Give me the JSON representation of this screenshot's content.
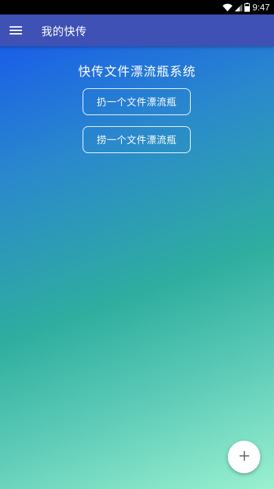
{
  "status_bar": {
    "time": "9:47",
    "icons": [
      "wifi-icon",
      "signal-icon",
      "battery-icon"
    ]
  },
  "app_bar": {
    "menu_icon": "hamburger-menu-icon",
    "title": "我的快传",
    "color": "#3f51b5"
  },
  "main": {
    "heading": "快传文件漂流瓶系统",
    "throw_button_label": "扔一个文件漂流瓶",
    "pick_button_label": "捞一个文件漂流瓶",
    "gradient_colors": [
      "#1a5ee8",
      "#2fae9f",
      "#9af1d0"
    ]
  },
  "fab": {
    "icon": "plus-icon"
  }
}
